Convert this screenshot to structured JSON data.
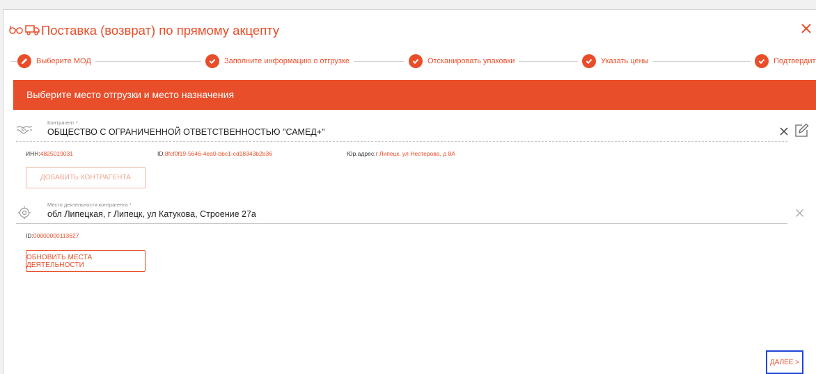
{
  "dialog": {
    "title": "Поставка (возврат) по прямому акцепту",
    "header_icons": [
      "glasses-icon",
      "truck-icon"
    ],
    "close_icon": "close-icon"
  },
  "steps": [
    {
      "label": "Выберите МОД",
      "state": "current",
      "icon": "pencil-icon"
    },
    {
      "label": "Заполните информацию о отгрузке",
      "state": "pending",
      "icon": "check-icon"
    },
    {
      "label": "Отсканировать упаковки",
      "state": "pending",
      "icon": "check-icon"
    },
    {
      "label": "Указать цены",
      "state": "pending",
      "icon": "check-icon"
    },
    {
      "label": "Подтвердить",
      "state": "pending",
      "icon": "check-icon"
    }
  ],
  "banner": {
    "text": "Выберите место отгрузки и место назначения"
  },
  "counterparty": {
    "label": "Контрагент *",
    "value": "ОБЩЕСТВО С ОГРАНИЧЕННОЙ ОТВЕТСТВЕННОСТЬЮ \"САМЕД+\"",
    "inn_key": "ИНН:",
    "inn": "4825019031",
    "id_key": "ID:",
    "id": "8fcf0f19-5646-4ea0-bbc1-cd18343b2b36",
    "address_key": "Юр.адрес:",
    "address": "г Липецк, ул Нестерова, д 8А",
    "add_button": "ДОБАВИТЬ КОНТРАГЕНТА",
    "icon": "handshake-icon"
  },
  "activity_place": {
    "label": "Место деятельности контрагента *",
    "value": "обл Липецкая, г Липецк, ул Катукова, Строение 27а",
    "id_key": "ID:",
    "id": "00000000113627",
    "refresh_button": "ОБНОВИТЬ МЕСТА ДЕЯТЕЛЬНОСТИ",
    "icon": "location-target-icon"
  },
  "footer": {
    "next_button": "ДАЛЕЕ >"
  },
  "colors": {
    "accent": "#e94e2a",
    "focus": "#1e45d6"
  }
}
